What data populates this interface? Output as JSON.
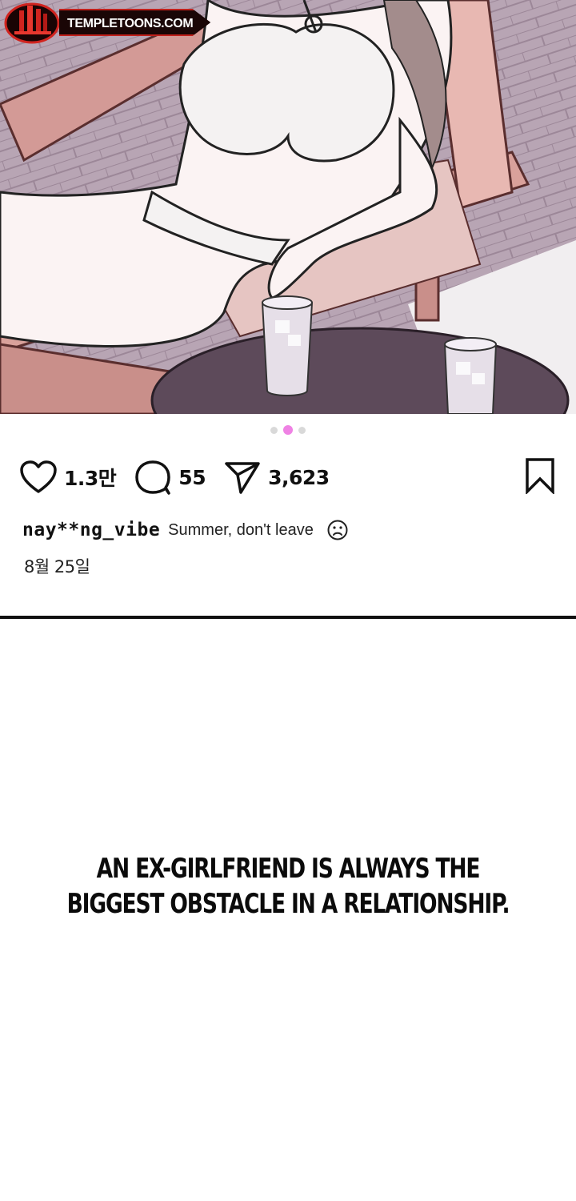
{
  "watermark": {
    "site": "TEMPLETOONS.COM"
  },
  "post": {
    "carousel": {
      "total": 3,
      "active_index": 1,
      "active_color": "#ef82e4",
      "inactive_color": "#d9d9d9"
    },
    "likes": "1.3만",
    "comments": "55",
    "shares": "3,623",
    "username": "nay**ng_vibe",
    "caption": "Summer, don't leave",
    "date": "8월 25일",
    "icons": [
      "heart-icon",
      "comment-icon",
      "send-icon",
      "bookmark-icon",
      "sad-face-icon"
    ]
  },
  "narration": {
    "line1": "AN EX-GIRLFRIEND IS ALWAYS THE",
    "line2": "BIGGEST OBSTACLE IN A RELATIONSHIP."
  }
}
